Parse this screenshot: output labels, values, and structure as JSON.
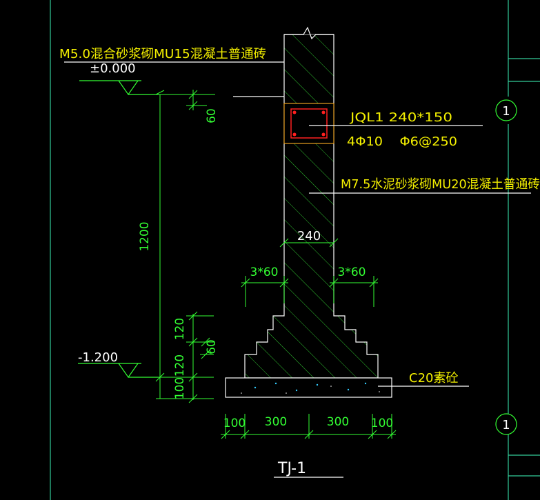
{
  "labels": {
    "wall_upper": "M5.0混合砂浆砌MU15混凝土普通砖",
    "level_zero": "±0.000",
    "beam_name": "JQL1 240*150",
    "beam_rebar": "4Φ10    Φ6@250",
    "wall_lower": "M7.5水泥砂浆砌MU20混凝土普通砖",
    "level_bottom": "-1.200",
    "cushion": "C20素砼",
    "title": "TJ-1"
  },
  "dims": {
    "d60_top": "60",
    "d1200": "1200",
    "d120_upper": "120",
    "d60_step": "60",
    "d120_lower": "120",
    "d100_left": "100",
    "w240": "240",
    "step_left": "3*60",
    "step_right": "3*60",
    "b100_left": "100",
    "b300_left": "300",
    "b300_right": "300",
    "b100_right": "100"
  },
  "axis_markers": [
    "1",
    "1"
  ],
  "colors": {
    "background": "#000000",
    "outline": "#ffffff",
    "hatch": "#33cc33",
    "dimension": "#33ff33",
    "text_yellow": "#f4f000",
    "beam_frame": "#e8a020",
    "rebar": "#ff2020",
    "frame_line": "#33cc99"
  }
}
